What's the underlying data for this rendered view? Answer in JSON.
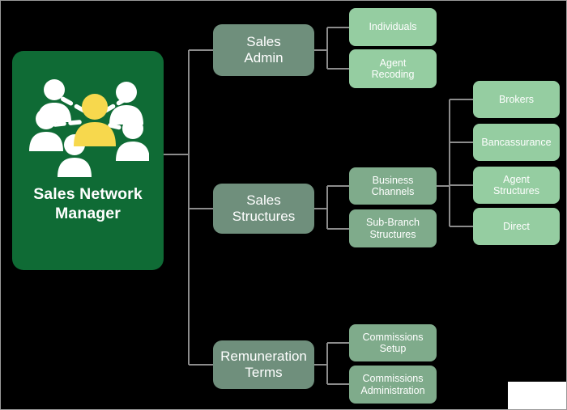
{
  "diagram": {
    "title": "Sales Network Manager",
    "type": "org-tree",
    "colors": {
      "background": "#000000",
      "root_card": "#0f6b35",
      "level1_node": "#6f8f7c",
      "level2_node": "#7fab8b",
      "level3_node": "#95cda1",
      "connector": "#8c8c8c",
      "text": "#ffffff",
      "icon_primary": "#ffffff",
      "icon_highlight": "#f6d košer"
    }
  },
  "root": {
    "label": "Sales Network\nManager",
    "icon": "people-network-icon"
  },
  "branches": [
    {
      "id": "sales-admin",
      "label": "Sales\nAdmin",
      "children": [
        {
          "id": "individuals",
          "label": "Individuals",
          "children": []
        },
        {
          "id": "agent-recoding",
          "label": "Agent\nRecoding",
          "children": []
        }
      ]
    },
    {
      "id": "sales-structures",
      "label": "Sales\nStructures",
      "children": [
        {
          "id": "business-channels",
          "label": "Business\nChannels",
          "children": [
            {
              "id": "brokers",
              "label": "Brokers"
            },
            {
              "id": "bancassurance",
              "label": "Bancassurance"
            },
            {
              "id": "agent-structures",
              "label": "Agent\nStructures"
            },
            {
              "id": "direct",
              "label": "Direct"
            }
          ]
        },
        {
          "id": "sub-branch-structures",
          "label": "Sub-Branch\nStructures",
          "children": []
        }
      ]
    },
    {
      "id": "remuneration-terms",
      "label": "Remuneration\nTerms",
      "children": [
        {
          "id": "commissions-setup",
          "label": "Commissions\nSetup",
          "children": []
        },
        {
          "id": "commissions-administration",
          "label": "Commissions\nAdministration",
          "children": []
        }
      ]
    }
  ]
}
